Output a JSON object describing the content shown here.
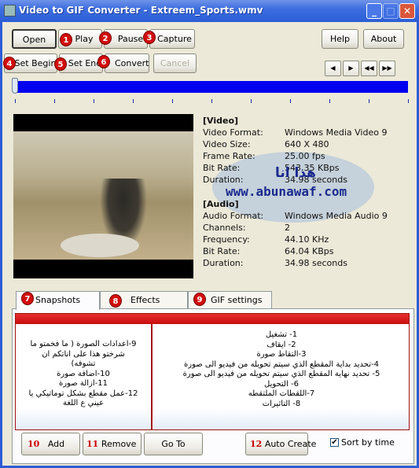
{
  "window": {
    "title": "Video to GIF Converter - Extreem_Sports.wmv",
    "controls": {
      "minimize": "_",
      "maximize": "□",
      "close": "✕"
    }
  },
  "toolbar": {
    "row1": [
      {
        "label": "Open",
        "badge": ""
      },
      {
        "label": "Play",
        "badge": "1"
      },
      {
        "label": "Pause",
        "badge": "2"
      },
      {
        "label": "Capture",
        "badge": "3"
      }
    ],
    "row2": [
      {
        "label": "Set Begin",
        "badge": "4"
      },
      {
        "label": "Set End",
        "badge": "5"
      },
      {
        "label": "Convert",
        "badge": "6"
      },
      {
        "label": "Cancel",
        "badge": "",
        "disabled": true
      }
    ],
    "help": "Help",
    "about": "About",
    "nav": [
      "◀",
      "▶",
      "◀◀",
      "▶▶"
    ]
  },
  "timeline": {
    "position_percent": 0
  },
  "info": {
    "video_header": "[Video]",
    "video": [
      {
        "k": "Video Format:",
        "v": "Windows Media Video 9"
      },
      {
        "k": "Video Size:",
        "v": "640 X 480"
      },
      {
        "k": "Frame Rate:",
        "v": "25.00 fps"
      },
      {
        "k": "Bit Rate:",
        "v": "543.35 KBps"
      },
      {
        "k": "Duration:",
        "v": "34.98 seconds"
      }
    ],
    "audio_header": "[Audio]",
    "audio": [
      {
        "k": "Audio Format:",
        "v": "Windows Media Audio 9"
      },
      {
        "k": "Channels:",
        "v": "2"
      },
      {
        "k": "Frequency:",
        "v": "44.10 KHz"
      },
      {
        "k": "Bit Rate:",
        "v": "64.04 KBps"
      },
      {
        "k": "Duration:",
        "v": "34.98 seconds"
      }
    ]
  },
  "watermark": {
    "line1": "هذا انا",
    "line2": "www.abunawaf.com"
  },
  "tabs": [
    {
      "label": "Snapshots",
      "badge": "7"
    },
    {
      "label": "Effects",
      "badge": "8"
    },
    {
      "label": "GIF settings",
      "badge": "9"
    }
  ],
  "notes": {
    "left": [
      "9-اعدادات الصورة ( ما فخمتو ما",
      "شرختو هذا على اناتكم ان",
      "تشوفه)",
      "10-اضافة صورة",
      "11-ازالة صورة",
      "12-عمل مقطع بشكل توماتيكي يا",
      "عيني ع اللغة"
    ],
    "right": [
      "1- تشغيل",
      "2- ايقاف",
      "3-التقاط صورة",
      "4-تحديد بداية المقطع الذي سيتم تحويله من فيديو الى صورة",
      "5- تحديد نهاية المقطع الذي سيتم تحويله من فيديو الى صورة",
      "6- التحويل",
      "7-اللقطات الملتقطه",
      "8- التاثيرات"
    ]
  },
  "bottom": {
    "add": {
      "num": "10",
      "label": "Add"
    },
    "remove": {
      "num": "11",
      "label": "Remove"
    },
    "goto": {
      "label": "Go To"
    },
    "auto": {
      "num": "12",
      "label": "Auto Create"
    },
    "sort": {
      "label": "Sort by time",
      "checked": true,
      "mark": "✔"
    }
  },
  "colors": {
    "accent_red": "#d20d0d",
    "track_blue": "#0000f0",
    "titlebar": "#2b5ed6"
  }
}
